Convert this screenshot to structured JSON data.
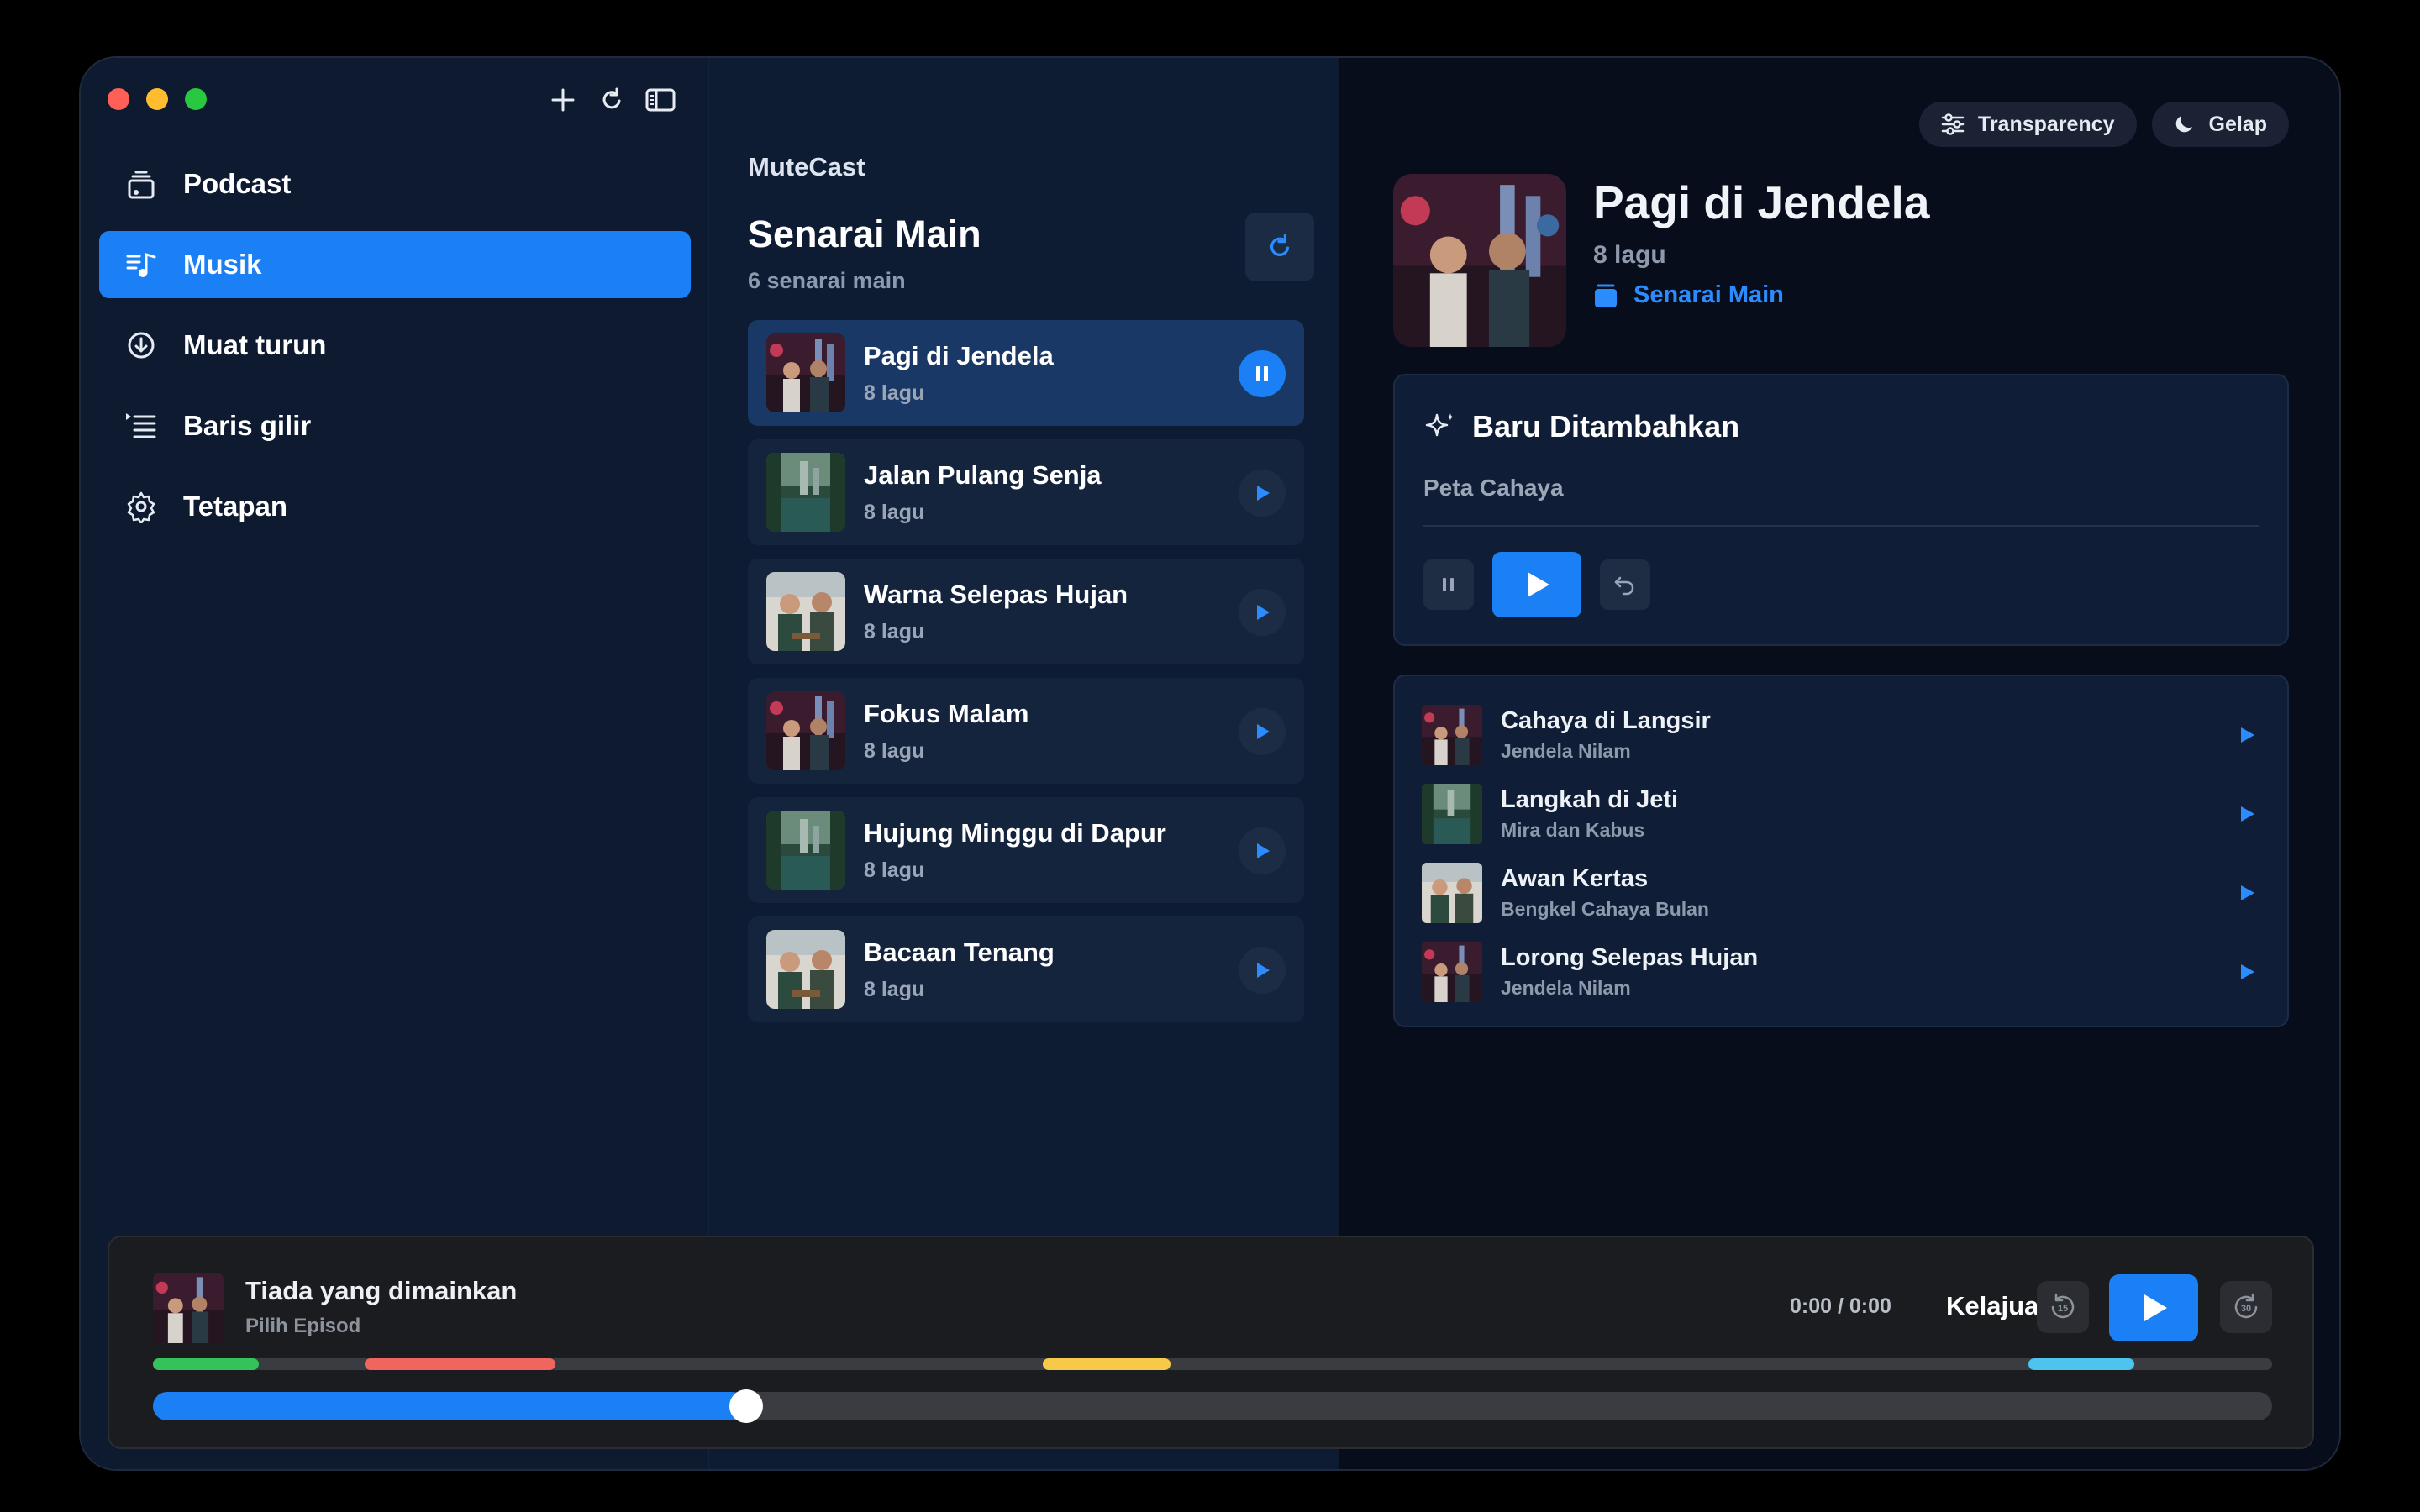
{
  "sidebar": {
    "items": [
      {
        "label": "Podcast",
        "icon": "podcast-icon",
        "active": false
      },
      {
        "label": "Musik",
        "icon": "music-icon",
        "active": true
      },
      {
        "label": "Muat turun",
        "icon": "download-icon",
        "active": false
      },
      {
        "label": "Baris gilir",
        "icon": "queue-icon",
        "active": false
      },
      {
        "label": "Tetapan",
        "icon": "gear-icon",
        "active": false
      }
    ]
  },
  "middle": {
    "app_name": "MuteCast",
    "title": "Senarai Main",
    "subtitle": "6 senarai main",
    "playlists": [
      {
        "name": "Pagi di Jendela",
        "count": "8 lagu",
        "playing": true
      },
      {
        "name": "Jalan Pulang Senja",
        "count": "8 lagu",
        "playing": false
      },
      {
        "name": "Warna Selepas Hujan",
        "count": "8 lagu",
        "playing": false
      },
      {
        "name": "Fokus Malam",
        "count": "8 lagu",
        "playing": false
      },
      {
        "name": "Hujung Minggu di Dapur",
        "count": "8 lagu",
        "playing": false
      },
      {
        "name": "Bacaan Tenang",
        "count": "8 lagu",
        "playing": false
      }
    ]
  },
  "detail": {
    "pills": {
      "transparency": "Transparency",
      "theme": "Gelap"
    },
    "title": "Pagi di Jendela",
    "count": "8 lagu",
    "link": "Senarai Main",
    "recent": {
      "heading": "Baru Ditambahkan",
      "track": "Peta Cahaya"
    },
    "tracks": [
      {
        "name": "Cahaya di Langsir",
        "artist": "Jendela Nilam"
      },
      {
        "name": "Langkah di Jeti",
        "artist": "Mira dan Kabus"
      },
      {
        "name": "Awan Kertas",
        "artist": "Bengkel Cahaya Bulan"
      },
      {
        "name": "Lorong Selepas Hujan",
        "artist": "Jendela Nilam"
      }
    ]
  },
  "player": {
    "title": "Tiada yang dimainkan",
    "subtitle": "Pilih Episod",
    "time": "0:00 / 0:00",
    "speed": "Kelajuan",
    "skip_back": "15",
    "skip_forward": "30",
    "progress_fraction": 0.28,
    "chapters": [
      {
        "color": "#34c35a",
        "start": 0.0,
        "end": 0.05
      },
      {
        "color": "#f0665e",
        "start": 0.1,
        "end": 0.19
      },
      {
        "color": "#f7c948",
        "start": 0.42,
        "end": 0.48
      },
      {
        "color": "#4cc4ee",
        "start": 0.885,
        "end": 0.935
      }
    ]
  },
  "colors": {
    "accent": "#1b7ff5"
  }
}
